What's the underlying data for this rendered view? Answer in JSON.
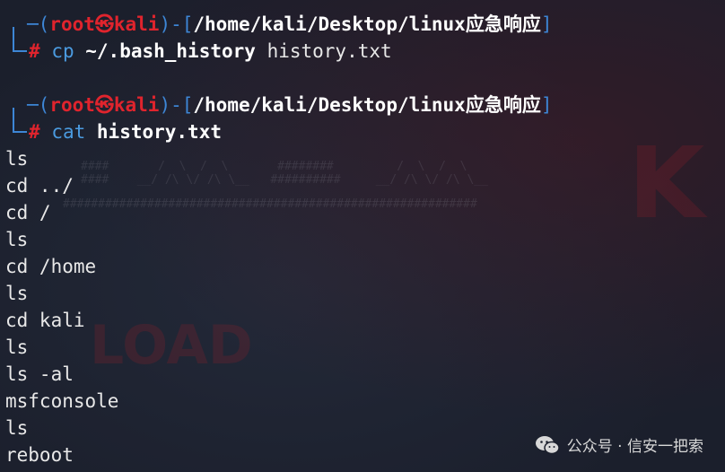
{
  "prompt": {
    "user": "root",
    "at_symbol": "㉿",
    "host": "kali",
    "path": "/home/kali/Desktop/linux应急响应",
    "hash": "#"
  },
  "commands": [
    {
      "cmd": "cp",
      "args": "~/.bash_history",
      "args2": "history.txt"
    },
    {
      "cmd": "cat",
      "args": "history.txt"
    }
  ],
  "output": [
    "ls",
    "cd ../",
    "cd /",
    "ls",
    "cd /home",
    "ls",
    "cd kali",
    "ls",
    "ls -al",
    "msfconsole",
    "ls",
    "reboot"
  ],
  "watermark": "公众号 · 信安一把索"
}
